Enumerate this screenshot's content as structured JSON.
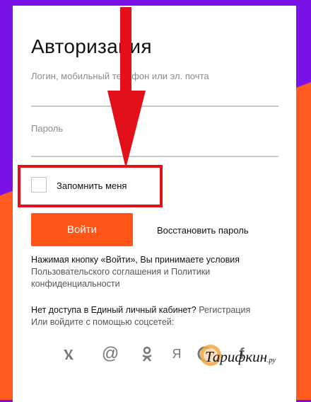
{
  "colors": {
    "purple_bg": "#7a12e8",
    "orange_bg": "#ff5b1f",
    "accent_button": "#ff5618",
    "highlight_red": "#e3101b"
  },
  "form": {
    "title": "Авторизация",
    "login_placeholder": "Логин, мобильный телефон или эл. почта",
    "password_placeholder": "Пароль",
    "remember_label": "Запомнить меня",
    "remember_checked": false,
    "login_button": "Войти",
    "restore_link": "Восстановить пароль"
  },
  "terms": {
    "line1": "Нажимая кнопку «Войти», Вы принимаете условия",
    "agreement_link": "Пользовательского соглашения",
    "and": " и ",
    "policy_link_part1": "Политики",
    "policy_link_part2": "конфиденциальности"
  },
  "access": {
    "question": "Нет доступа в Единый личный кабинет?",
    "register_link": "Регистрация",
    "social_prompt": "Или войдите с помощью соцсетей:"
  },
  "socials": [
    {
      "name": "vk-icon",
      "glyph": "VK"
    },
    {
      "name": "mail-icon",
      "glyph": "@"
    },
    {
      "name": "odnoklassniki-icon",
      "glyph": "ok"
    },
    {
      "name": "yandex-icon",
      "glyph": "Я"
    },
    {
      "name": "google-icon",
      "glyph": "G"
    },
    {
      "name": "facebook-icon",
      "glyph": "f"
    }
  ],
  "watermark": {
    "text": "Тарифкин",
    "suffix": ".ру"
  }
}
